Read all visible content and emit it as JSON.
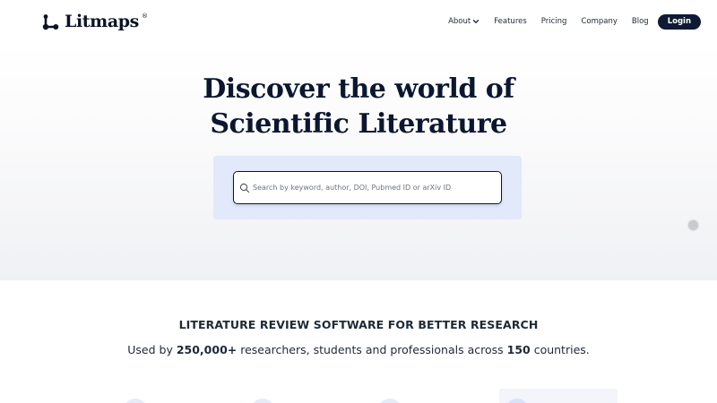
{
  "brand": {
    "name": "Litmaps",
    "registered": "®"
  },
  "nav": {
    "items": [
      {
        "label": "About",
        "has_dropdown": true
      },
      {
        "label": "Features"
      },
      {
        "label": "Pricing"
      },
      {
        "label": "Company"
      },
      {
        "label": "Blog"
      }
    ],
    "login_label": "Login"
  },
  "hero": {
    "title_line1": "Discover the world of",
    "title_line2": "Scientific Literature",
    "search": {
      "placeholder": "Search by keyword, author, DOI, Pubmed ID or arXiv ID",
      "value": ""
    }
  },
  "section": {
    "tagline": "LITERATURE REVIEW SOFTWARE FOR BETTER RESEARCH",
    "stats_prefix": "Used by ",
    "stats_users": "250,000+",
    "stats_middle": " researchers, students and professionals across ",
    "stats_countries": "150",
    "stats_suffix": " countries."
  },
  "colors": {
    "navy": "#0f1b33",
    "search_panel": "#e2e9fb",
    "hero_bottom": "#f0f1f4"
  },
  "icons": [
    "litmaps-logo-icon",
    "chevron-down-icon",
    "search-icon"
  ]
}
